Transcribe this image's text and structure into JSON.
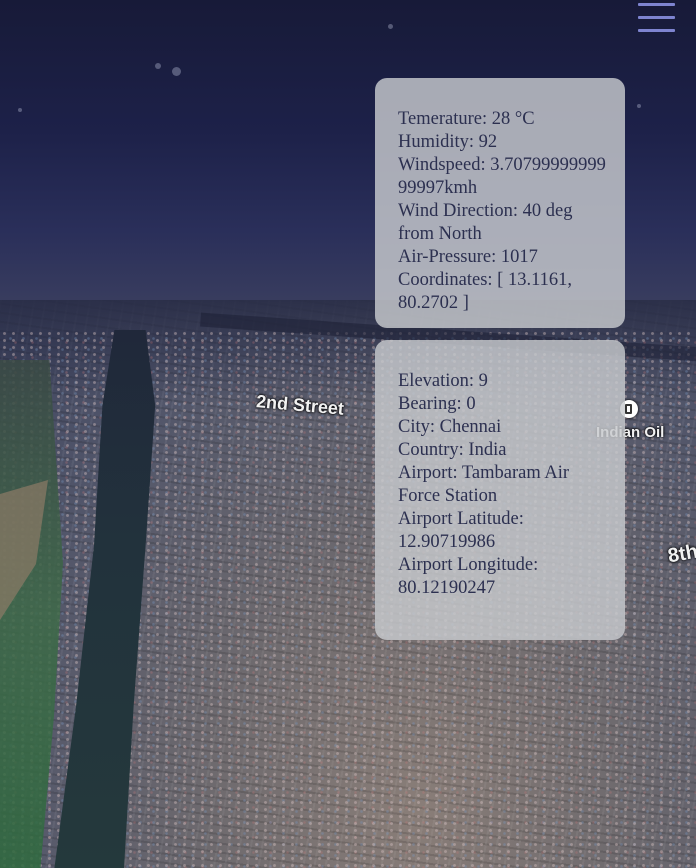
{
  "menu": {
    "icon": "hamburger-menu-icon",
    "color": "#7e84d0"
  },
  "map": {
    "labels": {
      "street_2nd": "2nd Street",
      "street_8th": "8th",
      "poi_fuel": "Indian Oil"
    },
    "poi_icon": "fuel-station-icon"
  },
  "weather_panel": {
    "temperature": "Temerature: 28 °C",
    "humidity": "Humidity: 92",
    "windspeed": "Windspeed: 3.7079999999999997kmh",
    "wind_direction": "Wind Direction: 40 deg from North",
    "air_pressure": "Air-Pressure: 1017",
    "coordinates": "Coordinates: [ 13.1161, 80.2702 ]"
  },
  "location_panel": {
    "elevation": "Elevation: 9",
    "bearing": "Bearing: 0",
    "city": "City: Chennai",
    "country": "Country: India",
    "airport": "Airport: Tambaram Air Force Station",
    "airport_latitude": "Airport Latitude: 12.90719986",
    "airport_longitude": "Airport Longitude: 80.12190247"
  }
}
